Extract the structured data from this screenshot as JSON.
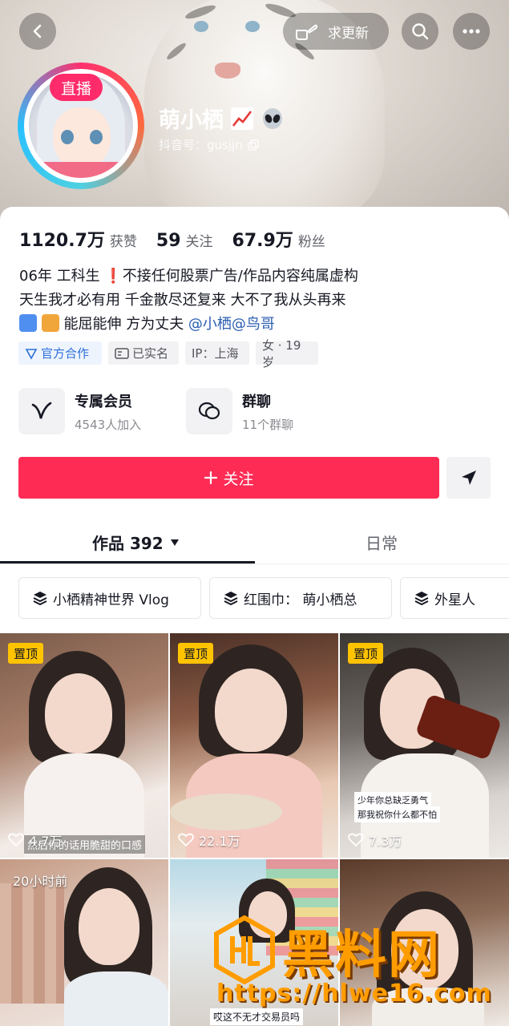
{
  "header": {
    "update_label": "求更新",
    "live_label": "直播"
  },
  "profile": {
    "nickname": "萌小栖",
    "douyin_id": "抖音号：gusjjn",
    "stats": [
      {
        "value": "1120.7万",
        "label": "获赞"
      },
      {
        "value": "59",
        "label": "关注"
      },
      {
        "value": "67.9万",
        "label": "粉丝"
      }
    ],
    "bio": {
      "line1": "06年  工科生  ❗不接任何股票广告/作品内容纯属虚构",
      "line2": "天生我才必有用 千金散尽还复来 大不了我从头再来",
      "line3_text": "能屈能伸 方为丈夫 ",
      "mention1": "@小栖",
      "mention2": "@鸟哥"
    },
    "tags": [
      {
        "label": "官方合作",
        "icon": "official-icon"
      },
      {
        "label": "已实名",
        "icon": "id-card-icon"
      },
      {
        "label": "IP：上海"
      },
      {
        "label": "女 · 19岁"
      }
    ]
  },
  "features": [
    {
      "title": "专属会员",
      "subtitle": "4543人加入",
      "icon": "vip-v-icon"
    },
    {
      "title": "群聊",
      "subtitle": "11个群聊",
      "icon": "chat-bubble-icon"
    }
  ],
  "actions": {
    "follow_label": "关注"
  },
  "tabs": {
    "works": "作品 392",
    "daily": "日常"
  },
  "collections": [
    {
      "label": "小栖精神世界 Vlog"
    },
    {
      "label": "红围巾： 萌小栖总"
    },
    {
      "label": "外星人"
    }
  ],
  "grid": [
    {
      "pin": "置顶",
      "likes": "4.7万",
      "caption": "然后你的话用脆甜的口感"
    },
    {
      "pin": "置顶",
      "likes": "22.1万"
    },
    {
      "pin": "置顶",
      "likes": "7.3万",
      "overlay_line1": "少年你总缺乏勇气",
      "overlay_line2": "那我祝你什么都不怕"
    },
    {
      "time": "20小时前"
    },
    {
      "caption": "哎这不无才交易员吗"
    },
    {}
  ],
  "watermark": {
    "brand": "黑料网",
    "url": "https://hlwe16.com"
  },
  "colors": {
    "follow": "#fe2c55",
    "pin": "#ffc300",
    "mention": "#2a5db0",
    "official": "#2c6fd6"
  }
}
